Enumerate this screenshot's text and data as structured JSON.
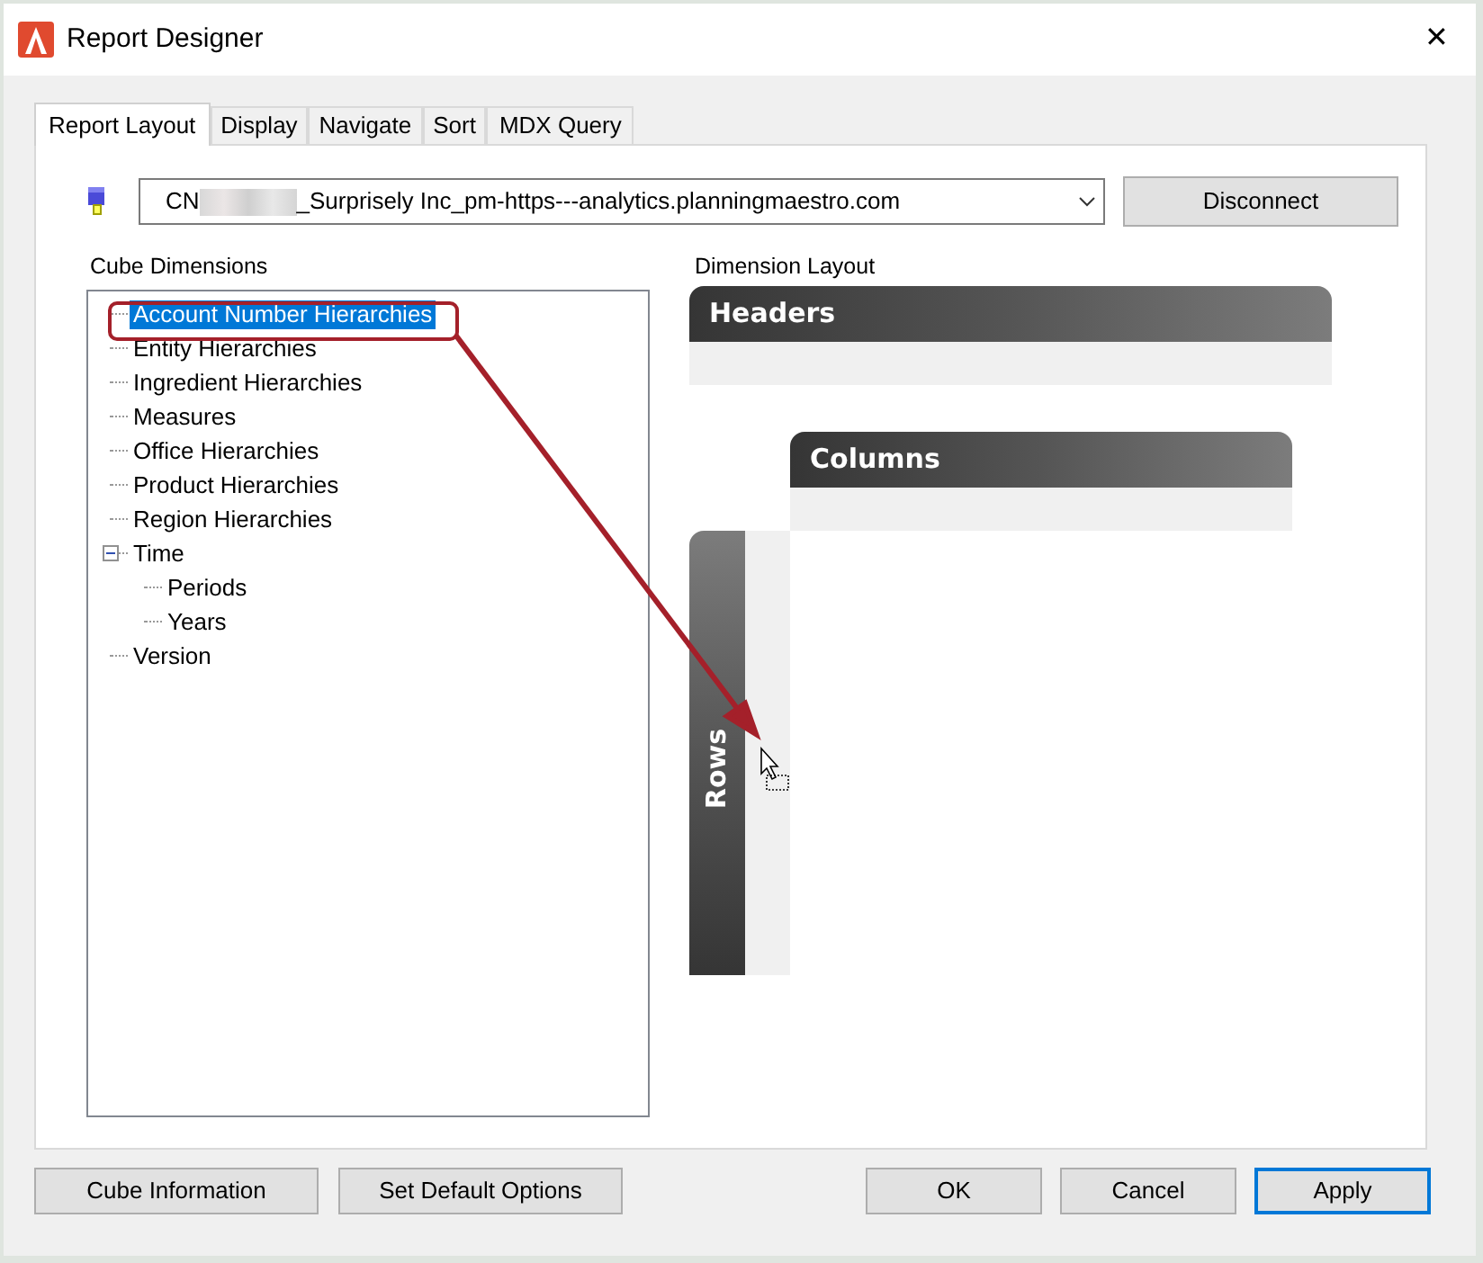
{
  "window": {
    "title": "Report Designer",
    "close": "✕"
  },
  "tabs": [
    {
      "label": "Report Layout",
      "selected": true
    },
    {
      "label": "Display",
      "selected": false
    },
    {
      "label": "Navigate",
      "selected": false
    },
    {
      "label": "Sort",
      "selected": false
    },
    {
      "label": "MDX Query",
      "selected": false
    }
  ],
  "connection": {
    "prefix": "CN",
    "suffix": "_Surprisely Inc_pm-https---analytics.planningmaestro.com",
    "button": "Disconnect"
  },
  "cube_dimensions": {
    "label": "Cube Dimensions",
    "items": [
      {
        "label": "Account Number Hierarchies",
        "selected": true
      },
      {
        "label": "Entity Hierarchies",
        "selected": false
      },
      {
        "label": "Ingredient Hierarchies",
        "selected": false
      },
      {
        "label": "Measures",
        "selected": false
      },
      {
        "label": "Office Hierarchies",
        "selected": false
      },
      {
        "label": "Product Hierarchies",
        "selected": false
      },
      {
        "label": "Region Hierarchies",
        "selected": false
      },
      {
        "label": "Time",
        "selected": false,
        "expanded": true,
        "children": [
          {
            "label": "Periods",
            "selected": false
          },
          {
            "label": "Years",
            "selected": false
          }
        ]
      },
      {
        "label": "Version",
        "selected": false
      }
    ]
  },
  "dimension_layout": {
    "label": "Dimension Layout",
    "headers": "Headers",
    "columns": "Columns",
    "rows": "Rows"
  },
  "buttons_left": [
    {
      "label": "Cube Information",
      "default": false
    },
    {
      "label": "Set Default Options",
      "default": false
    }
  ],
  "buttons_right": [
    {
      "label": "OK",
      "default": false
    },
    {
      "label": "Cancel",
      "default": false
    },
    {
      "label": "Apply",
      "default": true
    }
  ]
}
